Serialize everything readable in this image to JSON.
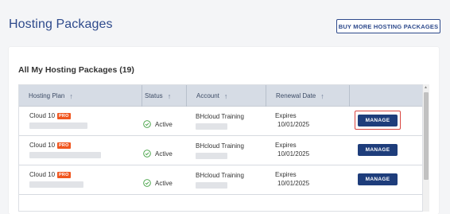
{
  "header": {
    "title": "Hosting Packages",
    "buy_more_label": "BUY MORE HOSTING PACKAGES"
  },
  "card": {
    "title": "All My Hosting Packages (19)"
  },
  "table": {
    "columns": [
      "Hosting Plan",
      "Status",
      "Account",
      "Renewal Date"
    ],
    "sort_icon": "arrow-up-icon",
    "rows": [
      {
        "plan": "Cloud 10",
        "badge": "PRO",
        "status": "Active",
        "account": "BHcloud Training",
        "renewal_label": "Expires",
        "renewal_date": "10/01/2025",
        "action": "MANAGE"
      },
      {
        "plan": "Cloud 10",
        "badge": "PRO",
        "status": "Active",
        "account": "BHcloud Training",
        "renewal_label": "Expires",
        "renewal_date": "10/01/2025",
        "action": "MANAGE"
      },
      {
        "plan": "Cloud 10",
        "badge": "PRO",
        "status": "Active",
        "account": "BHcloud Training",
        "renewal_label": "Expires",
        "renewal_date": "10/01/2025",
        "action": "MANAGE"
      }
    ]
  },
  "colors": {
    "brand": "#2e4a8c",
    "manage_button": "#1e3d7b",
    "pro_badge": "#f0561f",
    "status_active": "#3a9d3a",
    "highlight": "#d9443f"
  }
}
